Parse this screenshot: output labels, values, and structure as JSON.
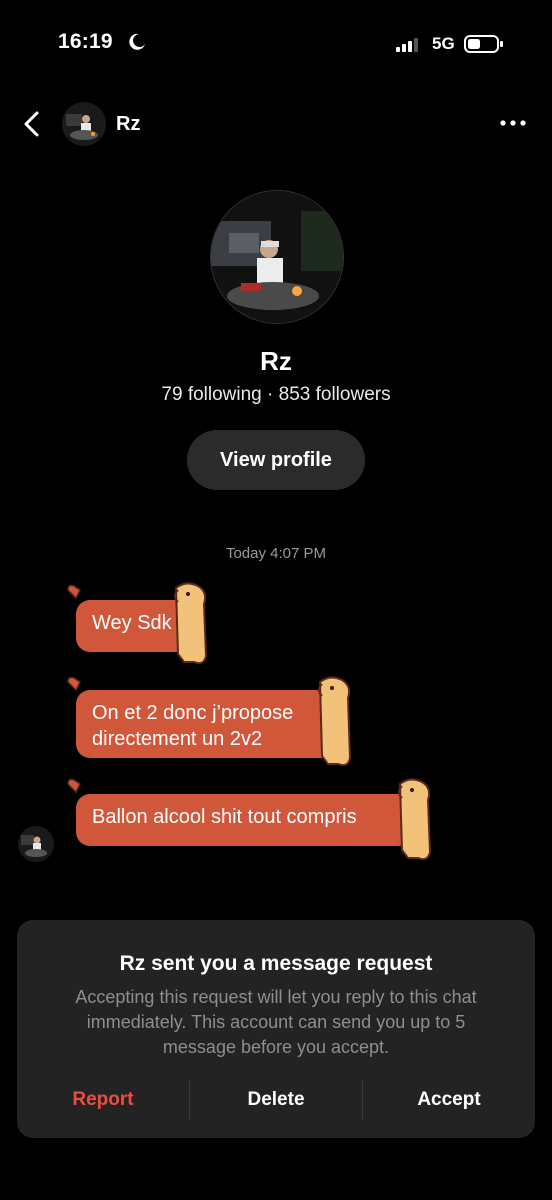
{
  "status_bar": {
    "time": "16:19",
    "network": "5G"
  },
  "header": {
    "name": "Rz"
  },
  "profile": {
    "name": "Rz",
    "stats": "79 following · 853 followers",
    "view_profile_label": "View profile"
  },
  "chat": {
    "timestamp": "Today 4:07 PM",
    "messages": [
      {
        "text": "Wey Sdk"
      },
      {
        "text": "On et 2 donc j’propose\ndirectement un 2v2"
      },
      {
        "text": "Ballon alcool shit tout compris"
      }
    ]
  },
  "request": {
    "title": "Rz sent you a message request",
    "description": "Accepting this request will let you reply to this chat immediately. This account can send you up to 5 message before you accept.",
    "report_label": "Report",
    "delete_label": "Delete",
    "accept_label": "Accept"
  },
  "colors": {
    "bubble": "#d1573b",
    "report": "#ef4b43",
    "panel": "#232323",
    "button": "#2b2b2b"
  }
}
